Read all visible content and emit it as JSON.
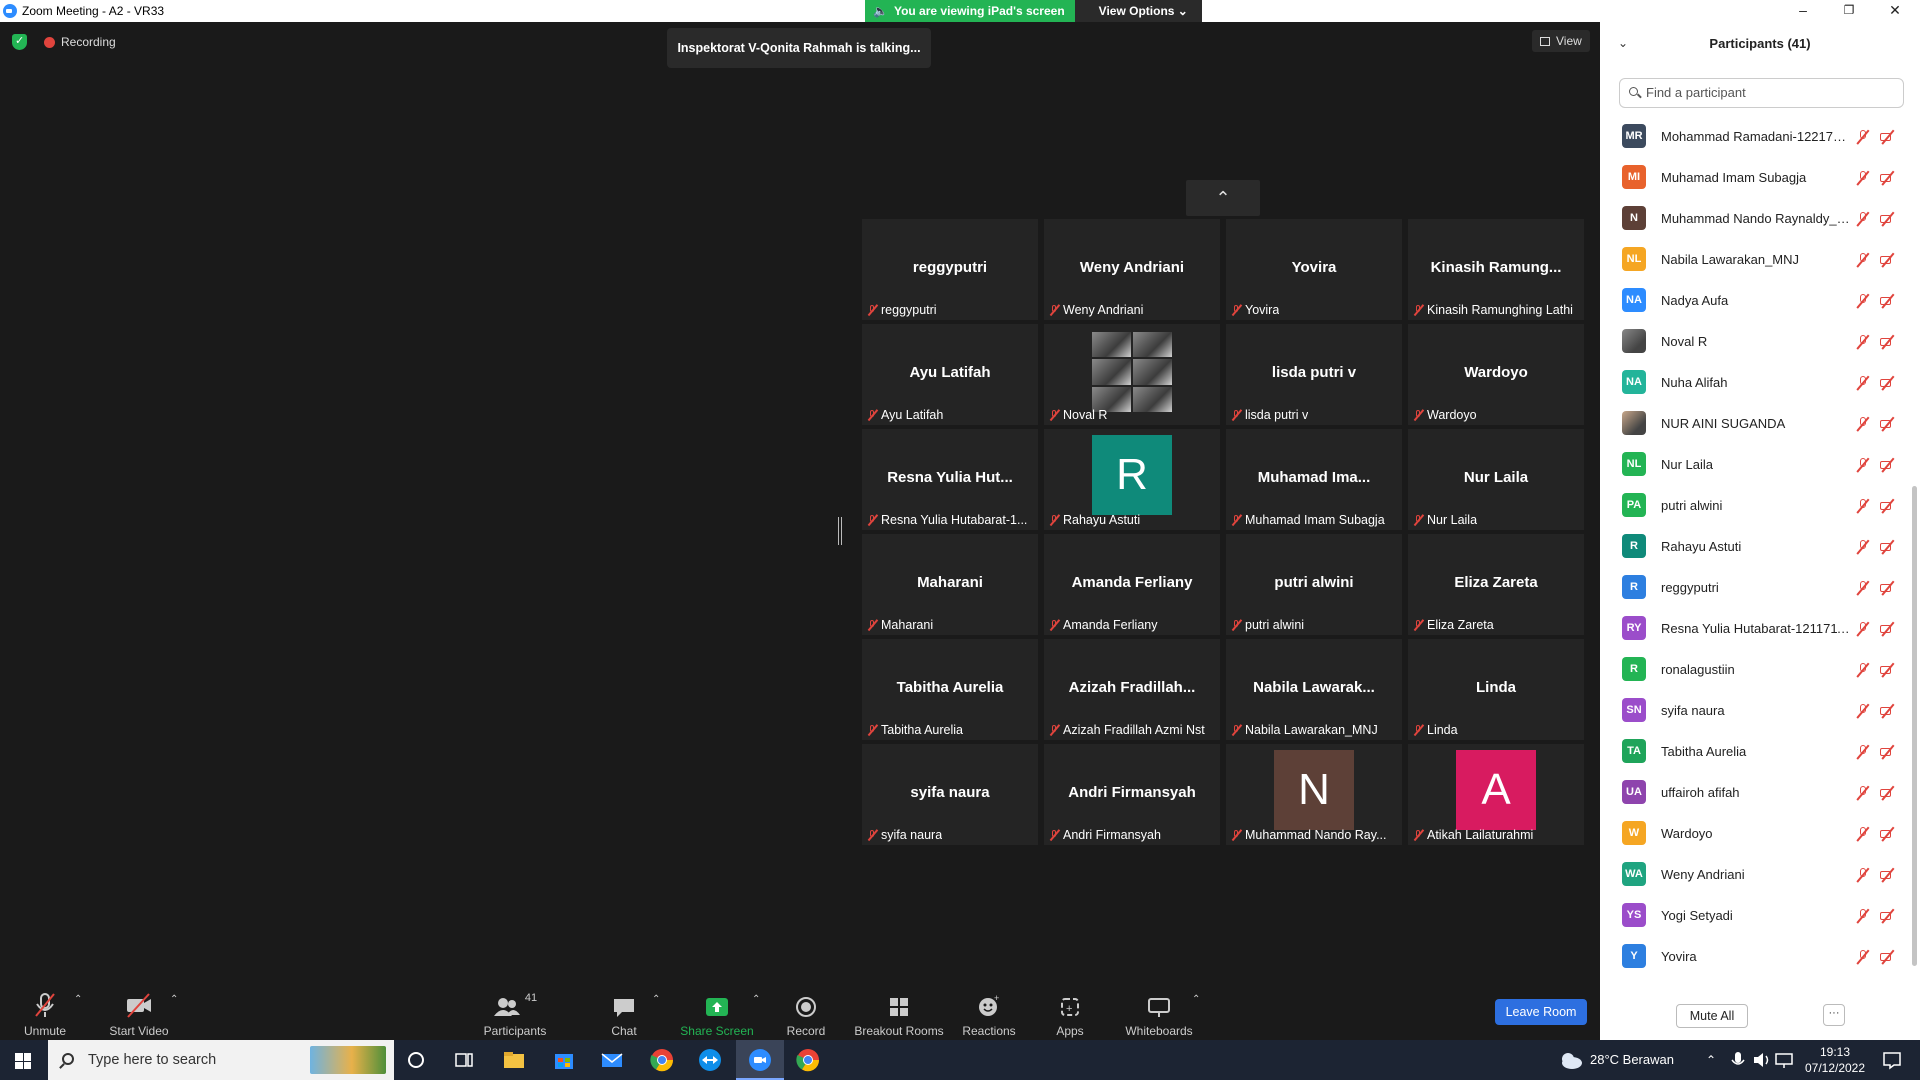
{
  "window": {
    "title": "Zoom Meeting - A2 - VR33"
  },
  "share_banner": {
    "status": "You are viewing iPad's screen",
    "options_label": "View Options"
  },
  "top": {
    "recording": "Recording",
    "talking": "Inspektorat V-Qonita Rahmah is talking...",
    "view_label": "View"
  },
  "tiles": [
    {
      "big": "reggyputri",
      "label": "reggyputri"
    },
    {
      "big": "Weny Andriani",
      "label": "Weny Andriani"
    },
    {
      "big": "Yovira",
      "label": "Yovira"
    },
    {
      "big": "Kinasih  Ramung...",
      "label": "Kinasih Ramunghing Lathi"
    },
    {
      "big": "Ayu Latifah",
      "label": "Ayu Latifah"
    },
    {
      "big": "",
      "label": "Noval R",
      "photo": true
    },
    {
      "big": "lisda putri v",
      "label": "lisda putri v"
    },
    {
      "big": "Wardoyo",
      "label": "Wardoyo"
    },
    {
      "big": "Resna  Yulia  Hut...",
      "label": "Resna Yulia Hutabarat-1..."
    },
    {
      "big": "",
      "label": "Rahayu Astuti",
      "avatar": "R",
      "avatar_color": "#0f8a7a"
    },
    {
      "big": "Muhamad  Ima...",
      "label": "Muhamad Imam Subagja"
    },
    {
      "big": "Nur Laila",
      "label": "Nur Laila"
    },
    {
      "big": "Maharani",
      "label": "Maharani"
    },
    {
      "big": "Amanda Ferliany",
      "label": "Amanda Ferliany"
    },
    {
      "big": "putri alwini",
      "label": "putri alwini"
    },
    {
      "big": "Eliza Zareta",
      "label": "Eliza Zareta"
    },
    {
      "big": "Tabitha Aurelia",
      "label": "Tabitha Aurelia"
    },
    {
      "big": "Azizah  Fradillah...",
      "label": "Azizah Fradillah Azmi Nst"
    },
    {
      "big": "Nabila  Lawarak...",
      "label": "Nabila Lawarakan_MNJ"
    },
    {
      "big": "Linda",
      "label": "Linda"
    },
    {
      "big": "syifa naura",
      "label": "syifa naura"
    },
    {
      "big": "Andri Firmansyah",
      "label": "Andri Firmansyah"
    },
    {
      "big": "",
      "label": "Muhammad Nando Ray...",
      "avatar": "N",
      "avatar_color": "#5d4037"
    },
    {
      "big": "",
      "label": "Atikah Lailaturahmi",
      "avatar": "A",
      "avatar_color": "#d81b60"
    }
  ],
  "toolbar": {
    "unmute": "Unmute",
    "start_video": "Start Video",
    "participants": "Participants",
    "participants_count": "41",
    "chat": "Chat",
    "share_screen": "Share Screen",
    "record": "Record",
    "breakout": "Breakout Rooms",
    "reactions": "Reactions",
    "apps": "Apps",
    "whiteboards": "Whiteboards",
    "leave": "Leave Room"
  },
  "panel": {
    "title": "Participants (41)",
    "search_placeholder": "Find a participant",
    "mute_all": "Mute All",
    "more": "···",
    "participants": [
      {
        "initials": "MR",
        "name": "Mohammad Ramadani-122171...",
        "color": "#3c4a5e"
      },
      {
        "initials": "MI",
        "name": "Muhamad Imam Subagja",
        "color": "#e8622c"
      },
      {
        "initials": "N",
        "name": "Muhammad Nando Raynaldy_1...",
        "color": "#5d4037"
      },
      {
        "initials": "NL",
        "name": "Nabila Lawarakan_MNJ",
        "color": "#f5a623"
      },
      {
        "initials": "NA",
        "name": "Nadya Aufa",
        "color": "#2d8cff"
      },
      {
        "initials": "",
        "name": "Noval R",
        "color": "#888888",
        "photo": true
      },
      {
        "initials": "NA",
        "name": "Nuha Alifah",
        "color": "#23b49a"
      },
      {
        "initials": "",
        "name": "NUR AINI SUGANDA",
        "color": "#c9a88b",
        "photo": true
      },
      {
        "initials": "NL",
        "name": "Nur Laila",
        "color": "#23b454"
      },
      {
        "initials": "PA",
        "name": "putri alwini",
        "color": "#23b454"
      },
      {
        "initials": "R",
        "name": "Rahayu Astuti",
        "color": "#0f8a7a"
      },
      {
        "initials": "R",
        "name": "reggyputri",
        "color": "#2d7fe0"
      },
      {
        "initials": "RY",
        "name": "Resna Yulia Hutabarat-1211711...",
        "color": "#9b4dca"
      },
      {
        "initials": "R",
        "name": "ronalagustiin",
        "color": "#23b454"
      },
      {
        "initials": "SN",
        "name": "syifa naura",
        "color": "#9b4dca"
      },
      {
        "initials": "TA",
        "name": "Tabitha Aurelia",
        "color": "#1fa45a"
      },
      {
        "initials": "UA",
        "name": "uffairoh afifah",
        "color": "#8e44ad"
      },
      {
        "initials": "W",
        "name": "Wardoyo",
        "color": "#f5a623"
      },
      {
        "initials": "WA",
        "name": "Weny Andriani",
        "color": "#1fa480"
      },
      {
        "initials": "YS",
        "name": "Yogi Setyadi",
        "color": "#9b4dca"
      },
      {
        "initials": "Y",
        "name": "Yovira",
        "color": "#2d7fe0"
      }
    ]
  },
  "taskbar": {
    "search_placeholder": "Type here to search",
    "weather": "28°C  Berawan",
    "time": "19:13",
    "date": "07/12/2022"
  }
}
